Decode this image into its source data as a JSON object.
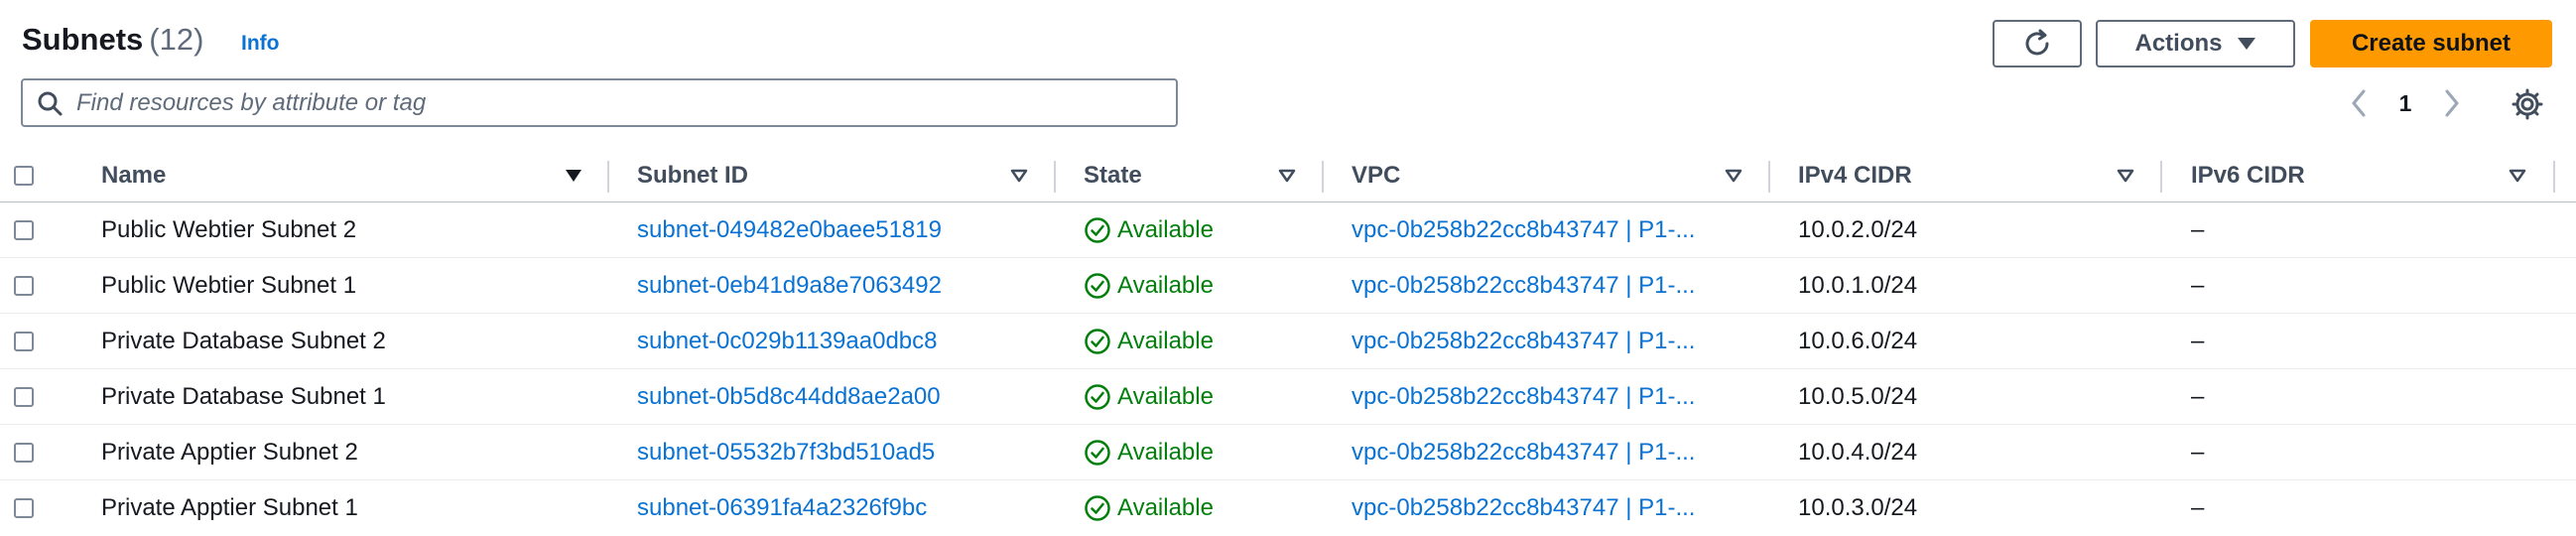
{
  "header": {
    "title": "Subnets",
    "count": "(12)",
    "info_link": "Info",
    "actions_label": "Actions",
    "create_label": "Create subnet"
  },
  "search": {
    "placeholder": "Find resources by attribute or tag"
  },
  "pagination": {
    "current_page": "1"
  },
  "table": {
    "columns": [
      "Name",
      "Subnet ID",
      "State",
      "VPC",
      "IPv4 CIDR",
      "IPv6 CIDR"
    ],
    "rows": [
      {
        "name": "Public Webtier Subnet 2",
        "subnet_id": "subnet-049482e0baee51819",
        "state": "Available",
        "vpc": "vpc-0b258b22cc8b43747 | P1-...",
        "ipv4": "10.0.2.0/24",
        "ipv6": "–"
      },
      {
        "name": "Public Webtier Subnet 1",
        "subnet_id": "subnet-0eb41d9a8e7063492",
        "state": "Available",
        "vpc": "vpc-0b258b22cc8b43747 | P1-...",
        "ipv4": "10.0.1.0/24",
        "ipv6": "–"
      },
      {
        "name": "Private Database Subnet 2",
        "subnet_id": "subnet-0c029b1139aa0dbc8",
        "state": "Available",
        "vpc": "vpc-0b258b22cc8b43747 | P1-...",
        "ipv4": "10.0.6.0/24",
        "ipv6": "–"
      },
      {
        "name": "Private Database Subnet 1",
        "subnet_id": "subnet-0b5d8c44dd8ae2a00",
        "state": "Available",
        "vpc": "vpc-0b258b22cc8b43747 | P1-...",
        "ipv4": "10.0.5.0/24",
        "ipv6": "–"
      },
      {
        "name": "Private Apptier Subnet 2",
        "subnet_id": "subnet-05532b7f3bd510ad5",
        "state": "Available",
        "vpc": "vpc-0b258b22cc8b43747 | P1-...",
        "ipv4": "10.0.4.0/24",
        "ipv6": "–"
      },
      {
        "name": "Private Apptier Subnet 1",
        "subnet_id": "subnet-06391fa4a2326f9bc",
        "state": "Available",
        "vpc": "vpc-0b258b22cc8b43747 | P1-...",
        "ipv4": "10.0.3.0/24",
        "ipv6": "–"
      }
    ]
  },
  "colors": {
    "primary_button": "#ff9900",
    "link": "#0972d3",
    "available_status": "#037f0c"
  },
  "icons": {
    "refresh": "refresh-icon",
    "actions_caret": "caret-down-icon",
    "search": "search-icon",
    "page_prev": "chevron-left-icon",
    "page_next": "chevron-right-icon",
    "settings": "gear-icon",
    "sort": "sort-caret-icon",
    "status": "check-circle-icon"
  }
}
